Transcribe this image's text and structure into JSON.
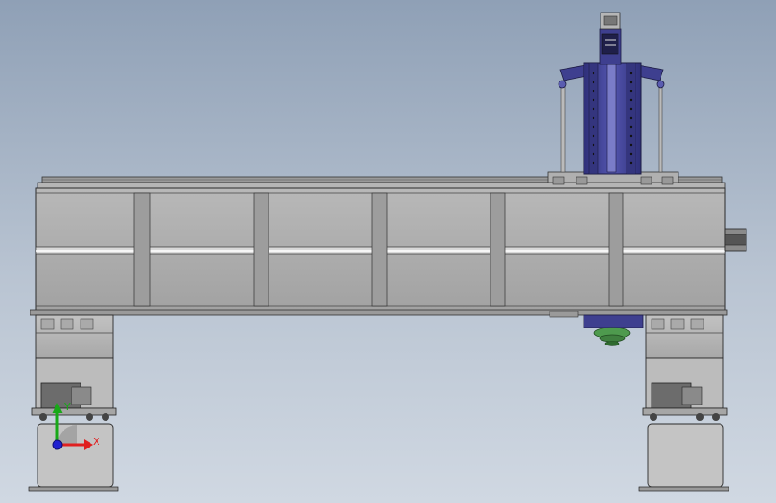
{
  "viewport": {
    "background_top": "#8fa0b6",
    "background_bottom": "#d0d8e2"
  },
  "model": {
    "frame_color": "#a4a4a4",
    "carriage_color": "#3e3f8f",
    "spindle_color": "#4e9a4e"
  },
  "triad": {
    "x_label": "X",
    "y_label": "Y",
    "x_color": "#e02020",
    "y_color": "#18a818",
    "z_color": "#2020d0"
  }
}
